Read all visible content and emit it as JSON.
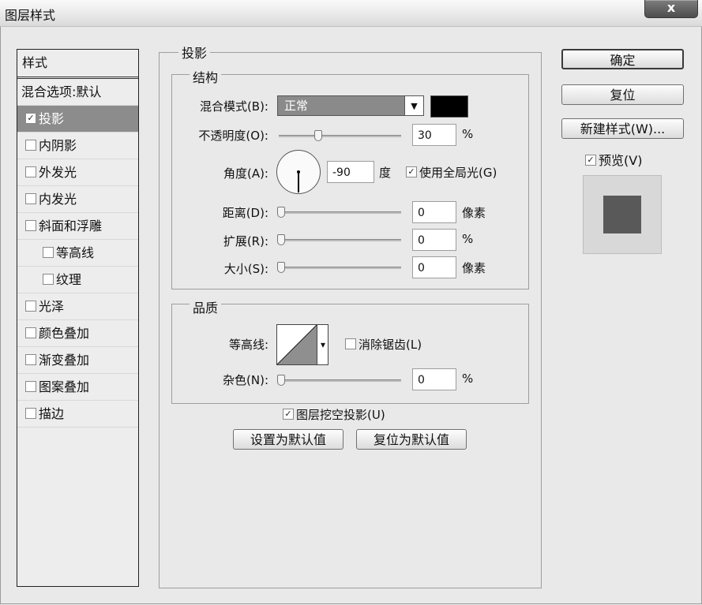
{
  "window": {
    "title": "图层样式",
    "close_glyph": "x"
  },
  "styles_panel": {
    "header": "样式",
    "items": [
      {
        "label": "混合选项:默认",
        "has_checkbox": false,
        "checked": false,
        "selected": false
      },
      {
        "label": "投影",
        "has_checkbox": true,
        "checked": true,
        "selected": true
      },
      {
        "label": "内阴影",
        "has_checkbox": true,
        "checked": false
      },
      {
        "label": "外发光",
        "has_checkbox": true,
        "checked": false
      },
      {
        "label": "内发光",
        "has_checkbox": true,
        "checked": false
      },
      {
        "label": "斜面和浮雕",
        "has_checkbox": true,
        "checked": false
      },
      {
        "label": "等高线",
        "has_checkbox": true,
        "checked": false,
        "sub": true
      },
      {
        "label": "纹理",
        "has_checkbox": true,
        "checked": false,
        "sub": true
      },
      {
        "label": "光泽",
        "has_checkbox": true,
        "checked": false
      },
      {
        "label": "颜色叠加",
        "has_checkbox": true,
        "checked": false
      },
      {
        "label": "渐变叠加",
        "has_checkbox": true,
        "checked": false
      },
      {
        "label": "图案叠加",
        "has_checkbox": true,
        "checked": false
      },
      {
        "label": "描边",
        "has_checkbox": true,
        "checked": false
      }
    ]
  },
  "drop_shadow": {
    "title": "投影",
    "structure": {
      "title": "结构",
      "blend_mode_label": "混合模式(B):",
      "blend_mode_value": "正常",
      "blend_mode_arrow": "▼",
      "shadow_color": "#000000",
      "opacity_label": "不透明度(O):",
      "opacity_value": "30",
      "opacity_fraction": 0.3,
      "opacity_unit": "%",
      "angle_label": "角度(A):",
      "angle_value": "-90",
      "angle_unit": "度",
      "global_light_label": "使用全局光(G)",
      "global_light_checked": true,
      "distance_label": "距离(D):",
      "distance_value": "0",
      "distance_unit": "像素",
      "spread_label": "扩展(R):",
      "spread_value": "0",
      "spread_unit": "%",
      "size_label": "大小(S):",
      "size_value": "0",
      "size_unit": "像素"
    },
    "quality": {
      "title": "品质",
      "contour_label": "等高线:",
      "contour_arrow": "▾",
      "anti_alias_label": "消除锯齿(L)",
      "anti_alias_checked": false,
      "noise_label": "杂色(N):",
      "noise_value": "0",
      "noise_unit": "%"
    },
    "knockout_label": "图层挖空投影(U)",
    "knockout_checked": true,
    "make_default_label": "设置为默认值",
    "reset_default_label": "复位为默认值"
  },
  "actions": {
    "ok_label": "确定",
    "reset_label": "复位",
    "new_style_label": "新建样式(W)...",
    "preview_label": "预览(V)",
    "preview_checked": true
  },
  "check_glyph": "☑"
}
